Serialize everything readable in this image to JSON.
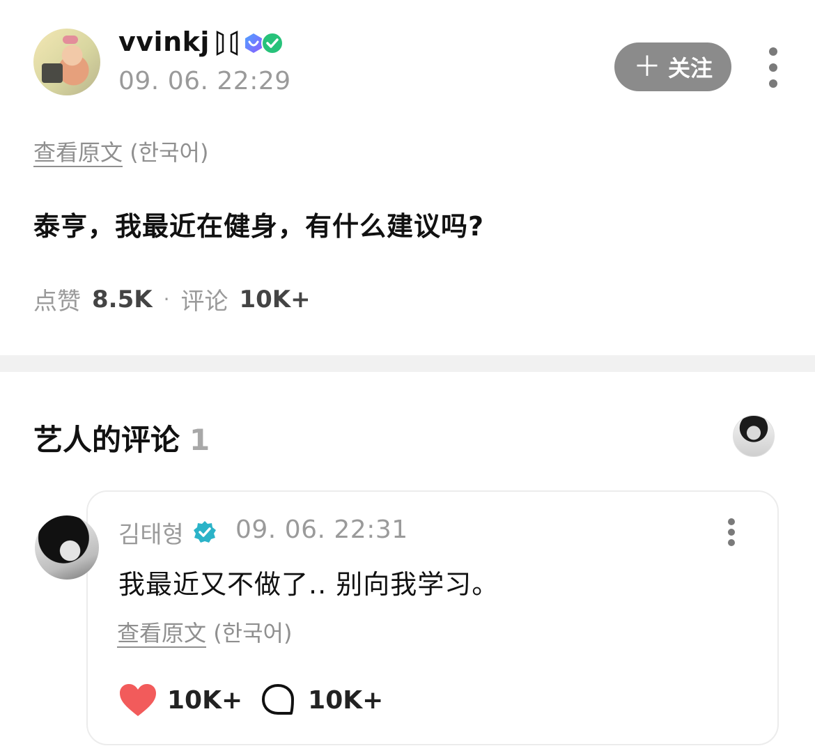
{
  "post": {
    "username": "vvinkj",
    "time": "09. 06. 22:29",
    "follow_label": "关注",
    "translate_link": "查看原文",
    "translate_lang": "(한국어)",
    "text": "泰亨，我最近在健身，有什么建议吗?",
    "likes_label": "点赞",
    "likes_value": "8.5K",
    "stats_separator": "·",
    "comments_label": "评论",
    "comments_value": "10K+"
  },
  "artist_comments": {
    "title": "艺人的评论",
    "count": "1"
  },
  "comment": {
    "author": "김태형",
    "time": "09. 06. 22:31",
    "text": "我最近又不做了.. 别向我学习。",
    "translate_link": "查看原文",
    "translate_lang": "(한국어)",
    "likes": "10K+",
    "replies": "10K+"
  },
  "colors": {
    "follow_bg": "#8b8b8b",
    "heart": "#f25b5b",
    "verified": "#2bb3c8",
    "muted_text": "#9a9a9a"
  },
  "icons": [
    "bts-logo-icon",
    "membership-badge-icon",
    "check-badge-icon",
    "plus-icon",
    "more-icon",
    "verified-icon",
    "heart-icon",
    "comment-bubble-icon"
  ]
}
